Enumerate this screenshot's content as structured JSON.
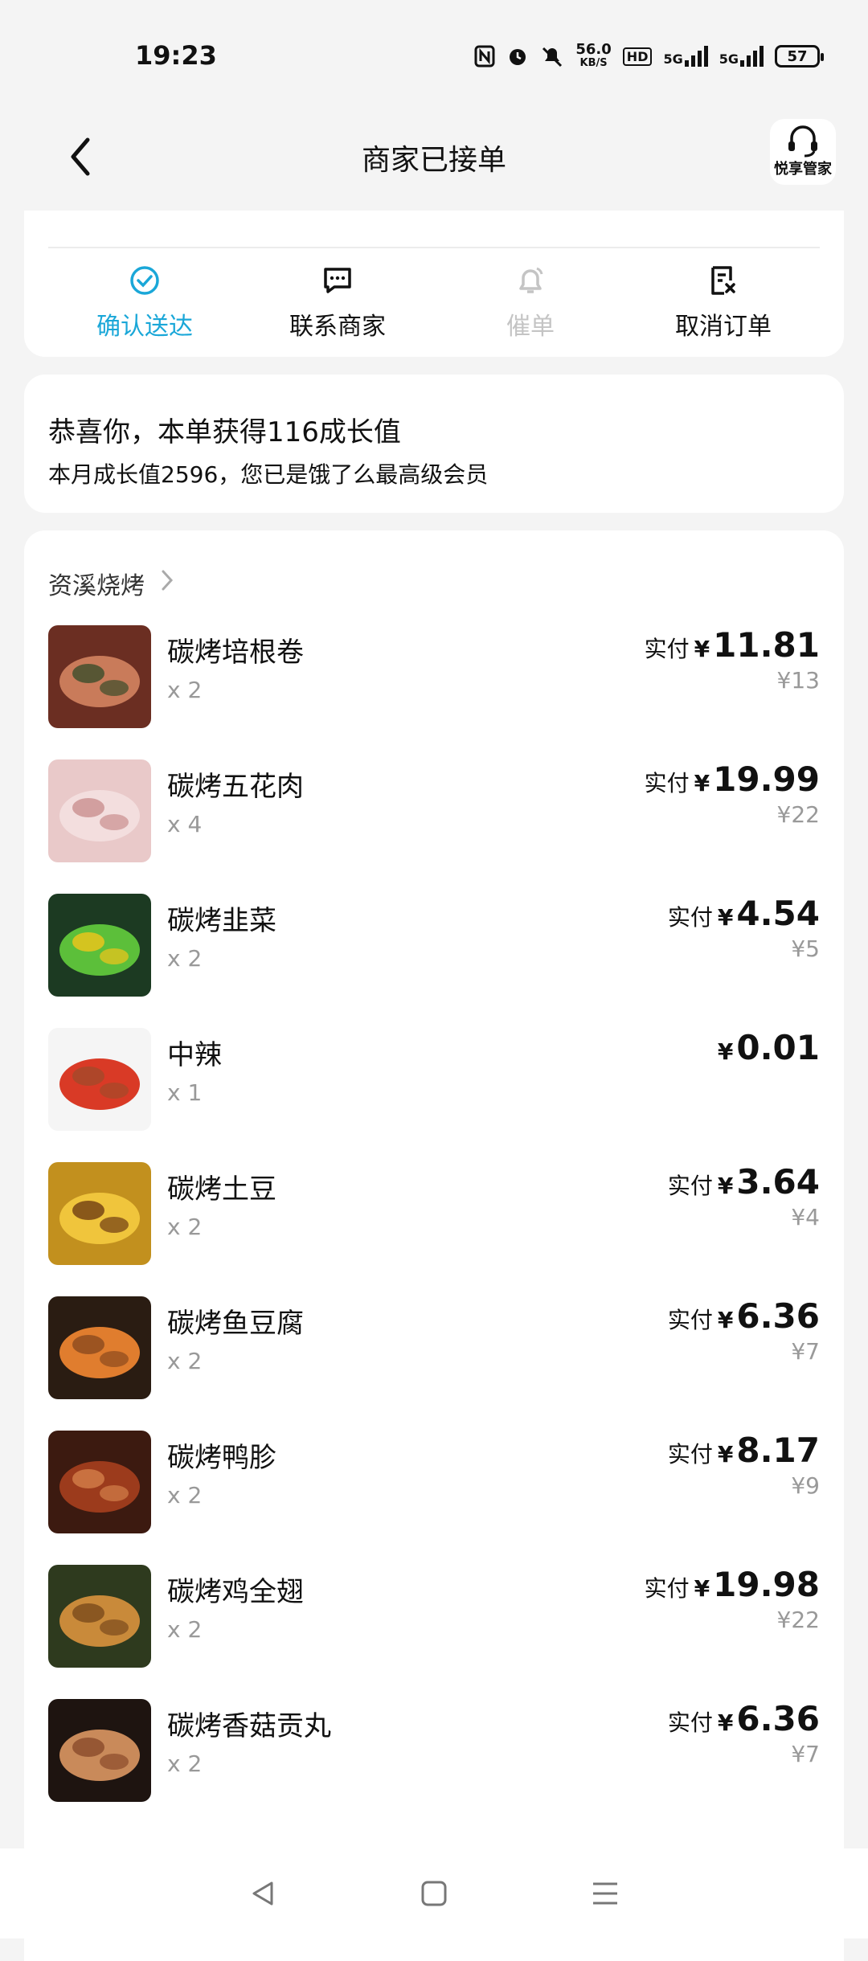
{
  "status_bar": {
    "time": "19:23",
    "net_speed_value": "56.0",
    "net_speed_unit": "KB/S",
    "hd_label": "HD",
    "signal1_label": "5G",
    "signal2_label": "5G",
    "battery": "57"
  },
  "header": {
    "title": "商家已接单",
    "butler_label": "悦享管家"
  },
  "actions": [
    {
      "label": "确认送达",
      "state": "active"
    },
    {
      "label": "联系商家",
      "state": "normal"
    },
    {
      "label": "催单",
      "state": "disabled"
    },
    {
      "label": "取消订单",
      "state": "normal"
    }
  ],
  "growth": {
    "line1": "恭喜你，本单获得116成长值",
    "line2": "本月成长值2596，您已是饿了么最高级会员"
  },
  "order": {
    "shop_name": "资溪烧烤",
    "paid_label": "实付",
    "currency": "¥",
    "items": [
      {
        "name": "碳烤培根卷",
        "qty": "x 2",
        "price": "11.81",
        "original": "¥13",
        "paid": true
      },
      {
        "name": "碳烤五花肉",
        "qty": "x 4",
        "price": "19.99",
        "original": "¥22",
        "paid": true
      },
      {
        "name": "碳烤韭菜",
        "qty": "x 2",
        "price": "4.54",
        "original": "¥5",
        "paid": true
      },
      {
        "name": "中辣",
        "qty": "x 1",
        "price": "0.01",
        "original": "",
        "paid": false
      },
      {
        "name": "碳烤土豆",
        "qty": "x 2",
        "price": "3.64",
        "original": "¥4",
        "paid": true
      },
      {
        "name": "碳烤鱼豆腐",
        "qty": "x 2",
        "price": "6.36",
        "original": "¥7",
        "paid": true
      },
      {
        "name": "碳烤鸭胗",
        "qty": "x 2",
        "price": "8.17",
        "original": "¥9",
        "paid": true
      },
      {
        "name": "碳烤鸡全翅",
        "qty": "x 2",
        "price": "19.98",
        "original": "¥22",
        "paid": true
      },
      {
        "name": "碳烤香菇贡丸",
        "qty": "x 2",
        "price": "6.36",
        "original": "¥7",
        "paid": true
      }
    ]
  },
  "colors": {
    "accent": "#1aa7d8",
    "muted": "#999999",
    "disabled": "#c4c4c4"
  }
}
